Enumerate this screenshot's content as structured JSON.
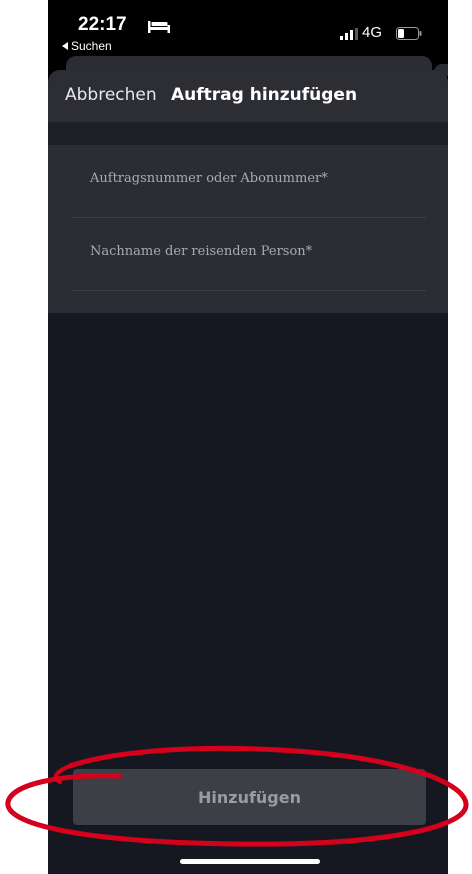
{
  "status_bar": {
    "time": "22:17",
    "back_label": "Suchen",
    "network": "4G",
    "icons": [
      "bed-icon",
      "back-arrow-icon",
      "signal-icon",
      "battery-icon"
    ]
  },
  "nav": {
    "cancel_label": "Abbrechen",
    "title": "Auftrag hinzufügen"
  },
  "form": {
    "fields": [
      {
        "placeholder": "Auftragsnummer oder Abonummer*"
      },
      {
        "placeholder": "Nachname der reisenden Person*"
      }
    ]
  },
  "actions": {
    "add_label": "Hinzufügen"
  },
  "colors": {
    "sheet_background": "#151820",
    "nav_background": "#2c2e34",
    "form_background": "#2a2d33",
    "button_background": "#3c3f46",
    "annotation_red": "#d5001c"
  }
}
